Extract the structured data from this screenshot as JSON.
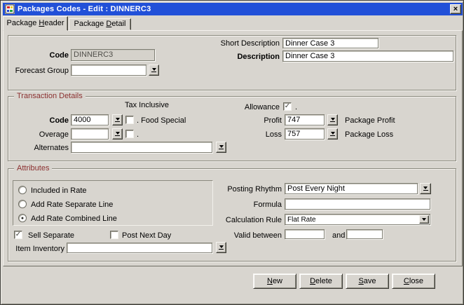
{
  "colors": {
    "titlebar_blue": "#2150d8",
    "section_title_maroon": "#8b3030",
    "face_grey": "#d8d5cf"
  },
  "window": {
    "title": "Packages Codes - Edit : DINNERC3",
    "close_glyph": "×"
  },
  "tabs": [
    {
      "pre": "Package ",
      "accel": "H",
      "post": "eader",
      "active": true
    },
    {
      "pre": "Package ",
      "accel": "D",
      "post": "etail",
      "active": false
    }
  ],
  "header": {
    "code": {
      "label": "Code",
      "value": "DINNERC3",
      "disabled": true
    },
    "forecast_group": {
      "label": "Forecast Group",
      "value": ""
    },
    "short_description": {
      "label": "Short Description",
      "value": "Dinner Case 3"
    },
    "description": {
      "label": "Description",
      "value": "Dinner Case 3"
    }
  },
  "transaction_details": {
    "title": "Transaction Details",
    "tax_inclusive_label": "Tax Inclusive",
    "code": {
      "label": "Code",
      "value": "4000",
      "mark": "",
      "checkbox_label": ". Food Special"
    },
    "overage": {
      "label": "Overage",
      "value": "",
      "mark": "",
      "checkbox_label": "."
    },
    "alternates": {
      "label": "Alternates",
      "value": ""
    },
    "allowance": {
      "label": "Allowance",
      "mark": "✓",
      "suffix": "."
    },
    "profit": {
      "label": "Profit",
      "value": "747",
      "desc": "Package Profit"
    },
    "loss": {
      "label": "Loss",
      "value": "757",
      "desc": "Package Loss"
    }
  },
  "attributes": {
    "title": "Attributes",
    "radio_options": [
      {
        "label": "Included in Rate",
        "mark": ""
      },
      {
        "label": "Add Rate Separate Line",
        "mark": ""
      },
      {
        "label": "Add Rate Combined Line",
        "mark": "●"
      }
    ],
    "sell_separate": {
      "label": "Sell Separate",
      "mark": "✓"
    },
    "post_next_day": {
      "label": "Post Next Day",
      "mark": ""
    },
    "item_inventory": {
      "label": "Item Inventory",
      "value": ""
    },
    "posting_rhythm": {
      "label": "Posting Rhythm",
      "value": "Post Every Night"
    },
    "formula": {
      "label": "Formula",
      "value": ""
    },
    "calculation_rule": {
      "label": "Calculation Rule",
      "value": "Flat Rate"
    },
    "valid_between": {
      "label": "Valid between",
      "from": "",
      "and_label": "and",
      "to": ""
    }
  },
  "buttons": [
    {
      "accel": "N",
      "post": "ew"
    },
    {
      "accel": "D",
      "post": "elete"
    },
    {
      "accel": "S",
      "post": "ave"
    },
    {
      "accel": "C",
      "post": "lose"
    }
  ]
}
